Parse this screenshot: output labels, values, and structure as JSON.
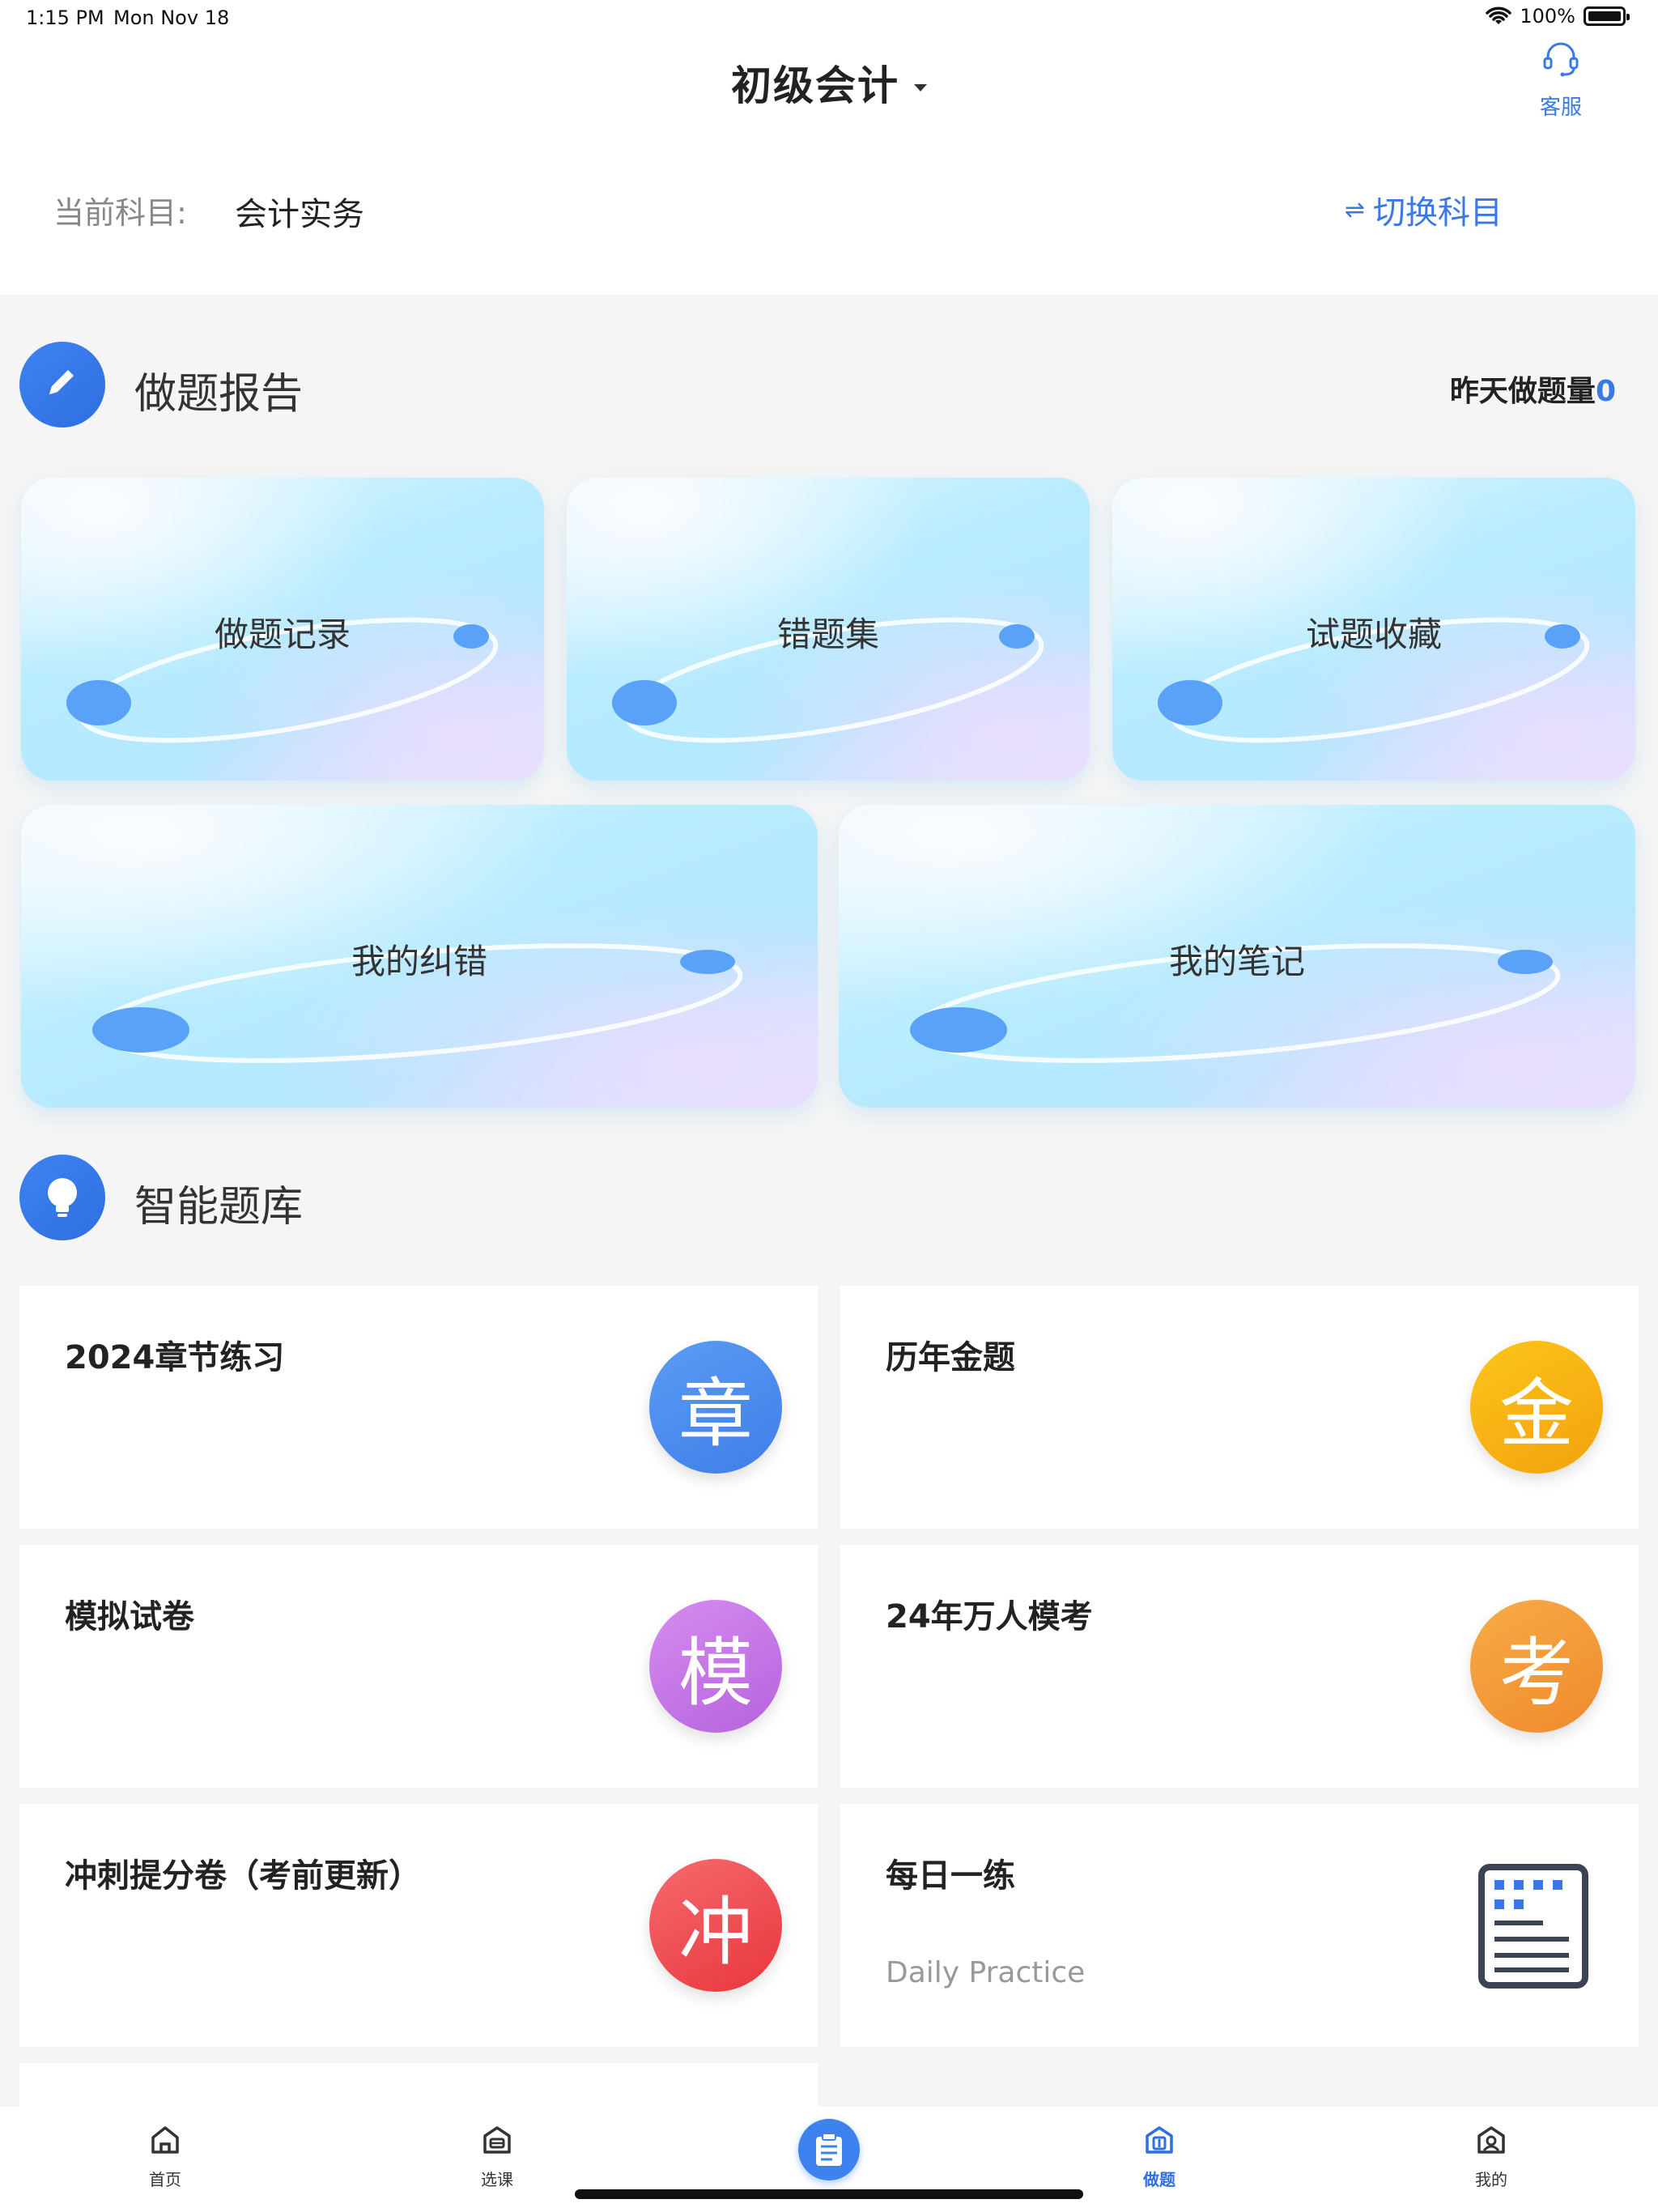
{
  "status_bar": {
    "time": "1:15 PM",
    "date": "Mon Nov 18",
    "battery": "100%"
  },
  "header": {
    "title": "初级会计",
    "service_label": "客服",
    "subject_label": "当前科目:",
    "subject_value": "会计实务",
    "switch_label": "切换科目",
    "switch_icon": "⇌"
  },
  "report": {
    "title": "做题报告",
    "yesterday_label": "昨天做题量",
    "yesterday_count": "0",
    "cards": [
      {
        "label": "做题记录"
      },
      {
        "label": "错题集"
      },
      {
        "label": "试题收藏"
      },
      {
        "label": "我的纠错"
      },
      {
        "label": "我的笔记"
      }
    ]
  },
  "bank": {
    "title": "智能题库",
    "items": [
      {
        "title": "2024章节练习",
        "badge": "章",
        "color": "#4a8ef0"
      },
      {
        "title": "历年金题",
        "badge": "金",
        "color": "#f7b514"
      },
      {
        "title": "模拟试卷",
        "badge": "模",
        "color": "#c97ae6"
      },
      {
        "title": "24年万人模考",
        "badge": "考",
        "color": "#f39a3a"
      },
      {
        "title": "冲刺提分卷（考前更新）",
        "badge": "冲",
        "color": "#f2545b"
      },
      {
        "title": "每日一练",
        "subtitle": "Daily Practice",
        "icon": "clipboard-list-icon"
      }
    ]
  },
  "tabs": [
    {
      "label": "首页",
      "icon": "home-icon"
    },
    {
      "label": "选课",
      "icon": "course-icon"
    },
    {
      "label": "做题",
      "icon": "practice-icon",
      "active": true
    },
    {
      "label": "我的",
      "icon": "profile-icon"
    }
  ]
}
